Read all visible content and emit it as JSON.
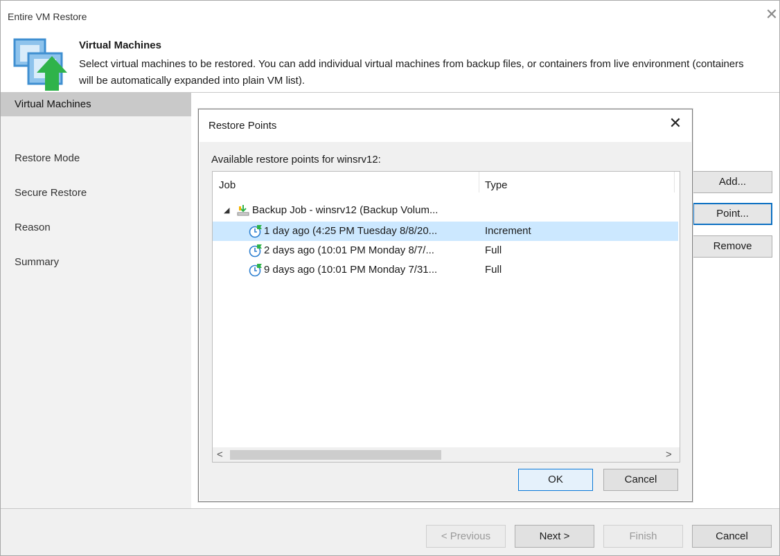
{
  "window": {
    "title": "Entire VM Restore"
  },
  "header": {
    "title": "Virtual Machines",
    "description": "Select virtual machines to be restored. You can add individual virtual machines from backup files, or containers from live environment (containers will be automatically expanded into plain VM list)."
  },
  "sidebar": {
    "items": [
      {
        "label": "Virtual Machines",
        "active": true
      },
      {
        "label": "Restore Mode"
      },
      {
        "label": "Secure Restore"
      },
      {
        "label": "Reason"
      },
      {
        "label": "Summary"
      }
    ]
  },
  "side_buttons": {
    "add": "Add...",
    "point": "Point...",
    "remove": "Remove"
  },
  "dialog": {
    "title": "Restore Points",
    "available_label": "Available restore points for winsrv12:",
    "columns": {
      "job": "Job",
      "type": "Type"
    },
    "tree": {
      "job_name": "Backup Job - winsrv12 (Backup Volum...",
      "points": [
        {
          "label": "1 day ago (4:25 PM Tuesday 8/8/20...",
          "type": "Increment",
          "selected": true
        },
        {
          "label": "2 days ago (10:01 PM Monday 8/7/...",
          "type": "Full"
        },
        {
          "label": "9 days ago (10:01 PM Monday 7/31...",
          "type": "Full"
        }
      ]
    },
    "ok": "OK",
    "cancel": "Cancel"
  },
  "footer": {
    "previous": "< Previous",
    "next": "Next >",
    "finish": "Finish",
    "cancel": "Cancel"
  },
  "icons": {
    "header": "vm-restore-icon",
    "job": "backup-job-icon",
    "point": "restore-point-clock-icon"
  },
  "colors": {
    "accent": "#0a78d7",
    "selection": "#cce8ff",
    "arrow_green": "#2fb34a",
    "vm_blue": "#3f8fd1"
  }
}
